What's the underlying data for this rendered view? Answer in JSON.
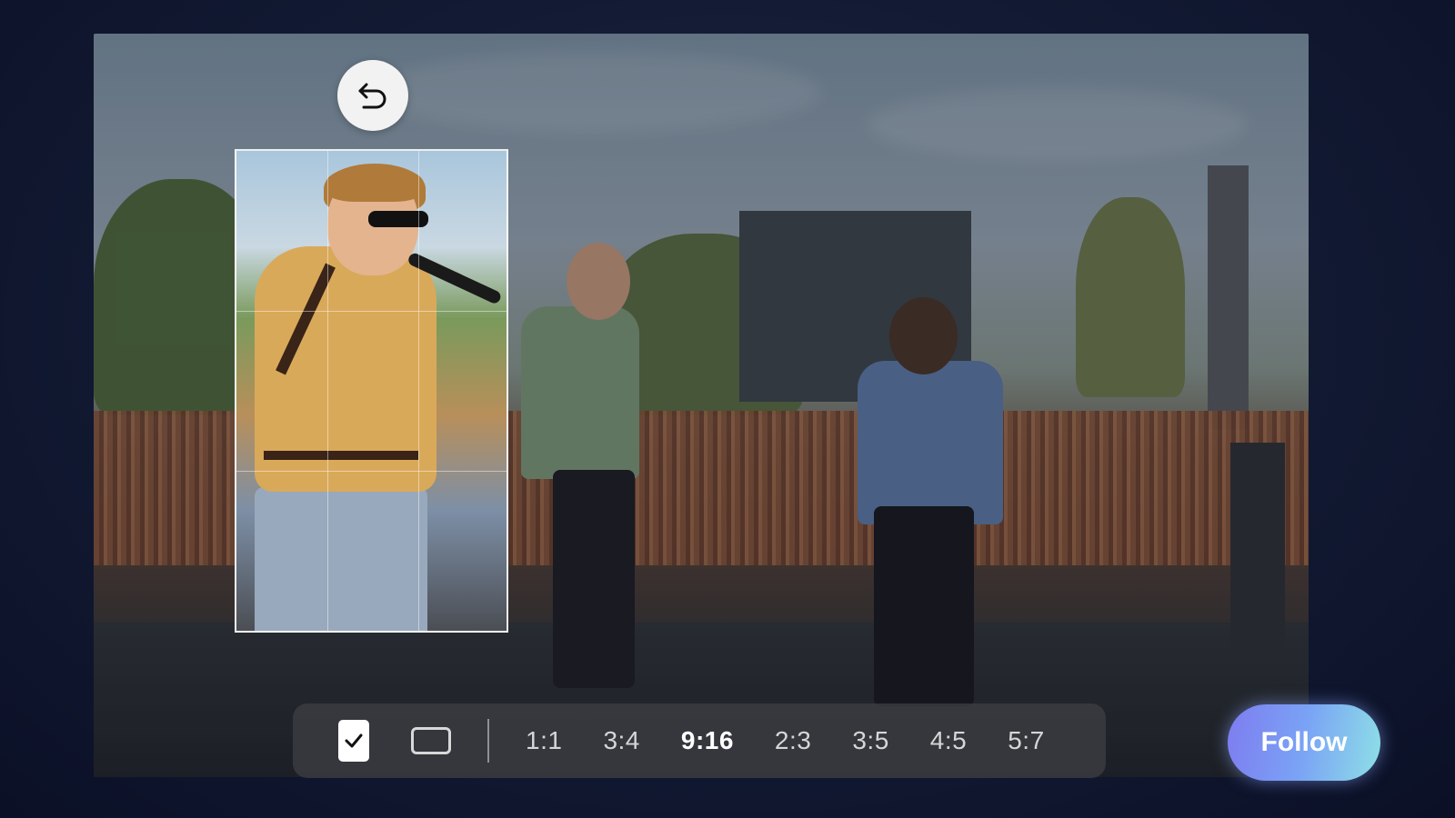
{
  "undo": {
    "icon": "undo-arrow-icon"
  },
  "crop_toolbar": {
    "check_icon": "check-icon",
    "rect_icon": "rectangle-outline-icon",
    "ratios": [
      "1:1",
      "3:4",
      "9:16",
      "2:3",
      "3:5",
      "4:5",
      "5:7"
    ],
    "active_ratio": "9:16"
  },
  "follow_button": {
    "label": "Follow"
  },
  "colors": {
    "follow_gradient_start": "#7e7cf0",
    "follow_gradient_end": "#8ee0e6",
    "toolbar_bg": "#3c3e42"
  }
}
